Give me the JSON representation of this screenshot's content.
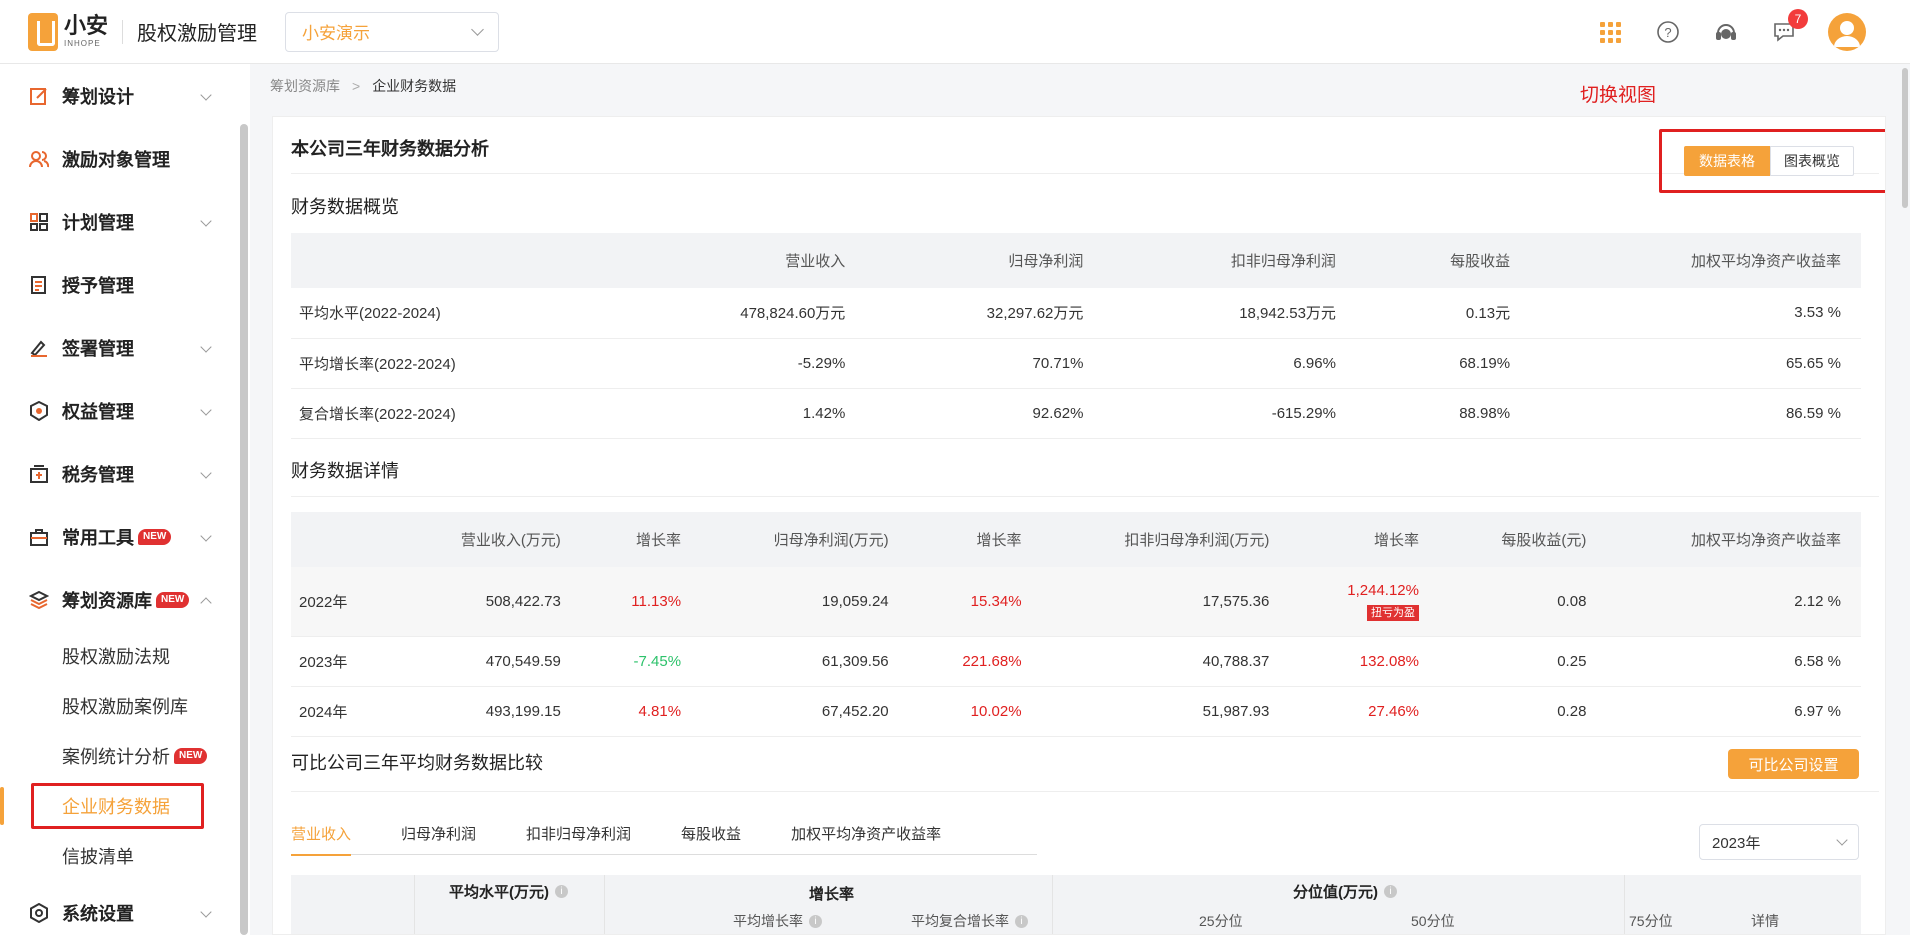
{
  "brand": {
    "name_cn": "小安",
    "name_en": "INHOPE",
    "app_title": "股权激励管理"
  },
  "org_select": {
    "value": "小安演示"
  },
  "header": {
    "notification_count": "7"
  },
  "sidebar": {
    "items": [
      {
        "label": "筹划设计",
        "icon": "edit-icon"
      },
      {
        "label": "激励对象管理",
        "icon": "users-icon"
      },
      {
        "label": "计划管理",
        "icon": "grid-icon"
      },
      {
        "label": "授予管理",
        "icon": "document-icon"
      },
      {
        "label": "签署管理",
        "icon": "signature-icon"
      },
      {
        "label": "权益管理",
        "icon": "badge-icon"
      },
      {
        "label": "税务管理",
        "icon": "tax-icon"
      },
      {
        "label": "常用工具",
        "icon": "toolbox-icon",
        "badge": "NEW"
      },
      {
        "label": "筹划资源库",
        "icon": "layers-icon",
        "badge": "NEW"
      }
    ],
    "subitems": [
      {
        "label": "股权激励法规"
      },
      {
        "label": "股权激励案例库"
      },
      {
        "label": "案例统计分析",
        "badge": "NEW"
      },
      {
        "label": "企业财务数据"
      },
      {
        "label": "信披清单"
      }
    ],
    "settings": {
      "label": "系统设置",
      "icon": "settings-icon"
    }
  },
  "breadcrumb": {
    "parent": "筹划资源库",
    "current": "企业财务数据"
  },
  "annotation": "切换视图",
  "card": {
    "title": "本公司三年财务数据分析",
    "view_switch": {
      "table": "数据表格",
      "chart": "图表概览"
    }
  },
  "overview": {
    "title": "财务数据概览",
    "headers": [
      "",
      "营业收入",
      "归母净利润",
      "扣非归母净利润",
      "每股收益",
      "加权平均净资产收益率"
    ],
    "rows": [
      [
        "平均水平(2022-2024)",
        "478,824.60万元",
        "32,297.62万元",
        "18,942.53万元",
        "0.13元",
        "3.53 %"
      ],
      [
        "平均增长率(2022-2024)",
        "-5.29%",
        "70.71%",
        "6.96%",
        "68.19%",
        "65.65 %"
      ],
      [
        "复合增长率(2022-2024)",
        "1.42%",
        "92.62%",
        "-615.29%",
        "88.98%",
        "86.59 %"
      ]
    ]
  },
  "details": {
    "title": "财务数据详情",
    "headers": [
      "",
      "营业收入(万元)",
      "增长率",
      "归母净利润(万元)",
      "增长率",
      "扣非归母净利润(万元)",
      "增长率",
      "每股收益(元)",
      "加权平均净资产收益率"
    ],
    "rows": [
      [
        "2022年",
        "508,422.73",
        "11.13%",
        "19,059.24",
        "15.34%",
        "17,575.36",
        "1,244.12%",
        "0.08",
        "2.12 %"
      ],
      [
        "2023年",
        "470,549.59",
        "-7.45%",
        "61,309.56",
        "221.68%",
        "40,788.37",
        "132.08%",
        "0.25",
        "6.58 %"
      ],
      [
        "2024年",
        "493,199.15",
        "4.81%",
        "67,452.20",
        "10.02%",
        "51,987.93",
        "27.46%",
        "0.28",
        "6.97 %"
      ]
    ],
    "tag": "扭亏为盈"
  },
  "comparison": {
    "title": "可比公司三年平均财务数据比较",
    "settings_button": "可比公司设置",
    "tabs": [
      "营业收入",
      "归母净利润",
      "扣非归母净利润",
      "每股收益",
      "加权平均净资产收益率"
    ],
    "year": "2023年",
    "table": {
      "avg_header": "平均水平(万元)",
      "growth_header": "增长率",
      "growth_sub": [
        "平均增长率",
        "平均复合增长率"
      ],
      "pct_header": "分位值(万元)",
      "pct_sub": [
        "25分位",
        "50分位",
        "75分位"
      ],
      "detail_header": "详情"
    }
  },
  "colors": {
    "accent": "#f5a23a",
    "annot": "#e02020",
    "up": "#e02020",
    "down": "#2dc26b"
  }
}
